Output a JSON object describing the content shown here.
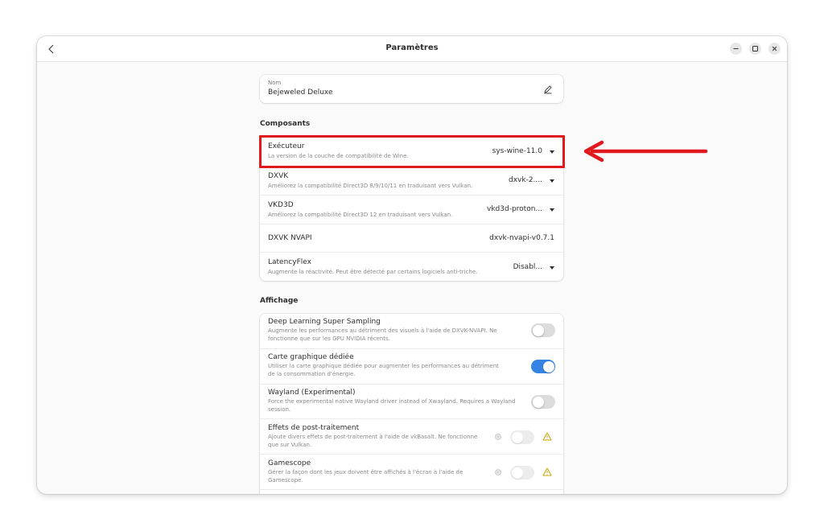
{
  "window": {
    "title": "Paramètres"
  },
  "name_field": {
    "label": "Nom",
    "value": "Bejeweled Deluxe"
  },
  "components": {
    "title": "Composants",
    "rows": [
      {
        "title": "Exécuteur",
        "subtitle": "La version de la couche de compatibilité de Wine.",
        "value": "sys-wine-11.0"
      },
      {
        "title": "DXVK",
        "subtitle": "Améliorez la compatibilité Direct3D 8/9/10/11 en traduisant vers Vulkan.",
        "value": "dxvk-2...."
      },
      {
        "title": "VKD3D",
        "subtitle": "Améliorez la compatibilité Direct3D 12 en traduisant vers Vulkan.",
        "value": "vkd3d-proton..."
      },
      {
        "title": "DXVK NVAPI",
        "value": "dxvk-nvapi-v0.7.1"
      },
      {
        "title": "LatencyFlex",
        "subtitle": "Augmente la réactivité. Peut être détecté par certains logiciels anti-triche.",
        "value": "Disabl..."
      }
    ]
  },
  "display": {
    "title": "Affichage",
    "rows": [
      {
        "title": "Deep Learning Super Sampling",
        "subtitle": "Augmente les performances au détriment des visuels à l'aide de DXVK-NVAPI. Ne fonctionne que sur les GPU NVIDIA récents.",
        "enabled": false
      },
      {
        "title": "Carte graphique dédiée",
        "subtitle": "Utiliser la carte graphique dédiée pour augmenter les performances au détriment de la consommation d'énergie.",
        "enabled": true
      },
      {
        "title": "Wayland (Experimental)",
        "subtitle": "Force the experimental native Wayland driver instead of Xwayland. Requires a Wayland session.",
        "enabled": false
      },
      {
        "title": "Effets de post-traitement",
        "subtitle": "Ajoute divers effets de post-traitement à l'aide de vkBasalt. Ne fonctionne que sur Vulkan.",
        "enabled": false
      },
      {
        "title": "Gamescope",
        "subtitle": "Gérer la façon dont les jeux doivent être affichés à l'écran à l'aide de Gamescope.",
        "enabled": false
      }
    ]
  },
  "colors": {
    "accent": "#3584e4",
    "annotation": "#e0191e",
    "warning": "#c9a400"
  }
}
